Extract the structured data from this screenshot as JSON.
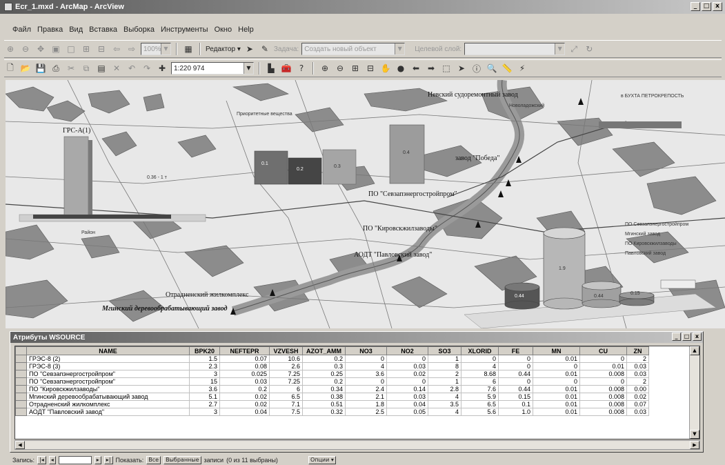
{
  "window": {
    "title": "Ecr_1.mxd - ArcMap - ArcView",
    "minimize": "_",
    "maximize": "□",
    "close": "x"
  },
  "menu": [
    "Файл",
    "Правка",
    "Вид",
    "Вставка",
    "Выборка",
    "Инструменты",
    "Окно",
    "Help"
  ],
  "toolbar1": {
    "zoom_combo": "100%",
    "editor_label": "Редактор ▾",
    "task_label": "Задача:",
    "task_value": "Создать новый объект",
    "target_label": "Целевой слой:",
    "target_value": ""
  },
  "toolbar2": {
    "scale_value": "1:220 974"
  },
  "map": {
    "labels": {
      "grs_a": "ГРС-А(1)",
      "bay": "в БУХТА ПЕТРОКРЕПОСТЬ",
      "nevsky": "Невский судоремонтный завод",
      "nevsky2": "Новоладожский",
      "zavod": "завод \"Победа\"",
      "po1": "ПО \"Севзапэнергостройпром\"",
      "po2": "ПО \"Кировскжилзаводы\"",
      "aodt": "АОДТ \"Павловский завод\"",
      "otrad": "Отрадненский жилкомплекс",
      "mgkh": "Мгинский деревообрабатывающий завод",
      "raion": "Район",
      "bar_label": "Приоритетные вещества",
      "legend1": "ПО Севзапэнергостройпром",
      "legend2": "Мгинский завод",
      "legend3": "ПО Кировскжилзаводы",
      "legend4": "Павловский завод",
      "cyl_val": "1.9",
      "cyl1": "0.44",
      "cyl3": "0.44",
      "cyl4": "0.15",
      "val_a": "0.1",
      "val_b": "0.2",
      "val_c": "0.3",
      "val_d": "0.4",
      "scale_small": "0.36 - 1 т"
    }
  },
  "attributes": {
    "title": "Атрибуты WSOURCE",
    "minimize": "_",
    "maximize": "□",
    "close": "x",
    "columns": [
      "NAME",
      "BPK20",
      "NEFTEPR",
      "VZVESH",
      "AZOT_AMM",
      "NO3",
      "NO2",
      "SO3",
      "XLORID",
      "FE",
      "MN",
      "CU",
      "ZN"
    ],
    "rows": [
      [
        "ГРЭС-8 (2)",
        "1.5",
        "0.07",
        "10.6",
        "0.2",
        "0",
        "0",
        "1",
        "0",
        "0",
        "0.01",
        "0",
        "2"
      ],
      [
        "ГРЭС-8 (3)",
        "2.3",
        "0.08",
        "2.6",
        "0.3",
        "4",
        "0.03",
        "8",
        "4",
        "0",
        "0",
        "0.01",
        "0.03"
      ],
      [
        "ПО \"Севзапэнергостройпром\"",
        "3",
        "0.025",
        "7.25",
        "0.25",
        "3.6",
        "0.02",
        "2",
        "8.68",
        "0.44",
        "0.01",
        "0.008",
        "0.03"
      ],
      [
        "ПО \"Севзапэнергостройпром\"",
        "15",
        "0.03",
        "7.25",
        "0.2",
        "0",
        "0",
        "1",
        "6",
        "0",
        "0",
        "0",
        "2"
      ],
      [
        "ПО \"Кировскжилзаводы\"",
        "3.6",
        "0.2",
        "6",
        "0.34",
        "2.4",
        "0.14",
        "2.8",
        "7.6",
        "0.44",
        "0.01",
        "0.008",
        "0.00"
      ],
      [
        "Мгинский деревообрабатывающий завод",
        "5.1",
        "0.02",
        "6.5",
        "0.38",
        "2.1",
        "0.03",
        "4",
        "5.9",
        "0.15",
        "0.01",
        "0.008",
        "0.02"
      ],
      [
        "Отрадненский жилкомплекс",
        "2.7",
        "0.02",
        "7.1",
        "0.51",
        "1.8",
        "0.04",
        "3.5",
        "6.5",
        "0.1",
        "0.01",
        "0.008",
        "0.07"
      ],
      [
        "АОДТ \"Павловский завод\"",
        "3",
        "0.04",
        "7.5",
        "0.32",
        "2.5",
        "0.05",
        "4",
        "5.6",
        "1.0",
        "0.01",
        "0.008",
        "0.03"
      ]
    ]
  },
  "recbar": {
    "label": "Запись:",
    "first": "|◂",
    "prev": "◂",
    "next": "▸",
    "last": "▸|",
    "show_label": "Показать:",
    "all": "Все",
    "selected": "Выбранные",
    "records": "записи",
    "count": "(0 из 11 выбраны)",
    "options": "Опции ▾"
  }
}
